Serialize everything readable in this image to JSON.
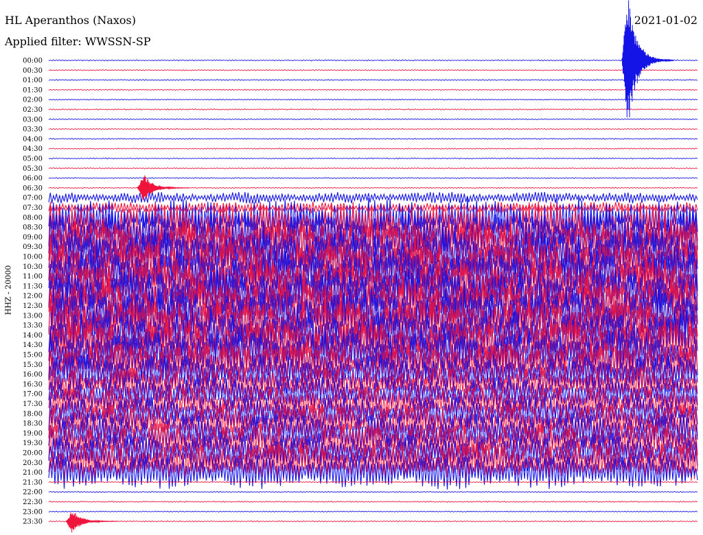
{
  "header": {
    "station": "HL Aperanthos (Naxos)",
    "filter": "Applied filter: WWSSN-SP",
    "date": "2021-01-02"
  },
  "channel_label": "HHZ - 20000",
  "colors": {
    "even_row": "#1414e6",
    "odd_row": "#f0143c",
    "text": "#000000"
  },
  "chart_data": {
    "type": "line",
    "title": "HL Aperanthos (Naxos)",
    "subtitle": "Applied filter: WWSSN-SP",
    "date": "2021-01-02",
    "ylabel": "HHZ - 20000",
    "row_labels": [
      "00:00",
      "00:30",
      "01:00",
      "01:30",
      "02:00",
      "02:30",
      "03:00",
      "03:30",
      "04:00",
      "04:30",
      "05:00",
      "05:30",
      "06:00",
      "06:30",
      "07:00",
      "07:30",
      "08:00",
      "08:30",
      "09:00",
      "09:30",
      "10:00",
      "10:30",
      "11:00",
      "11:30",
      "12:00",
      "12:30",
      "13:00",
      "13:30",
      "14:00",
      "14:30",
      "15:00",
      "15:30",
      "16:00",
      "16:30",
      "17:00",
      "17:30",
      "18:00",
      "18:30",
      "19:00",
      "19:30",
      "20:00",
      "20:30",
      "21:00",
      "21:30",
      "22:00",
      "22:30",
      "23:00",
      "23:30"
    ],
    "row_minutes": 30,
    "noise_level": [
      1,
      1,
      1,
      1,
      1,
      1,
      1,
      1,
      1,
      1,
      1,
      1,
      1,
      1,
      2,
      2,
      7,
      9,
      10,
      10,
      10,
      10,
      10,
      10,
      10,
      10,
      10,
      10,
      9,
      9,
      9,
      8,
      7,
      6,
      6,
      6,
      6,
      7,
      7,
      7,
      7,
      7,
      6,
      1,
      1,
      1,
      1,
      1
    ],
    "events": [
      {
        "row": 0,
        "minute": 26.5,
        "amplitude": 14
      },
      {
        "row": 13,
        "minute": 4.1,
        "amplitude": 3
      },
      {
        "row": 47,
        "minute": 0.8,
        "amplitude": 2.5
      }
    ]
  }
}
